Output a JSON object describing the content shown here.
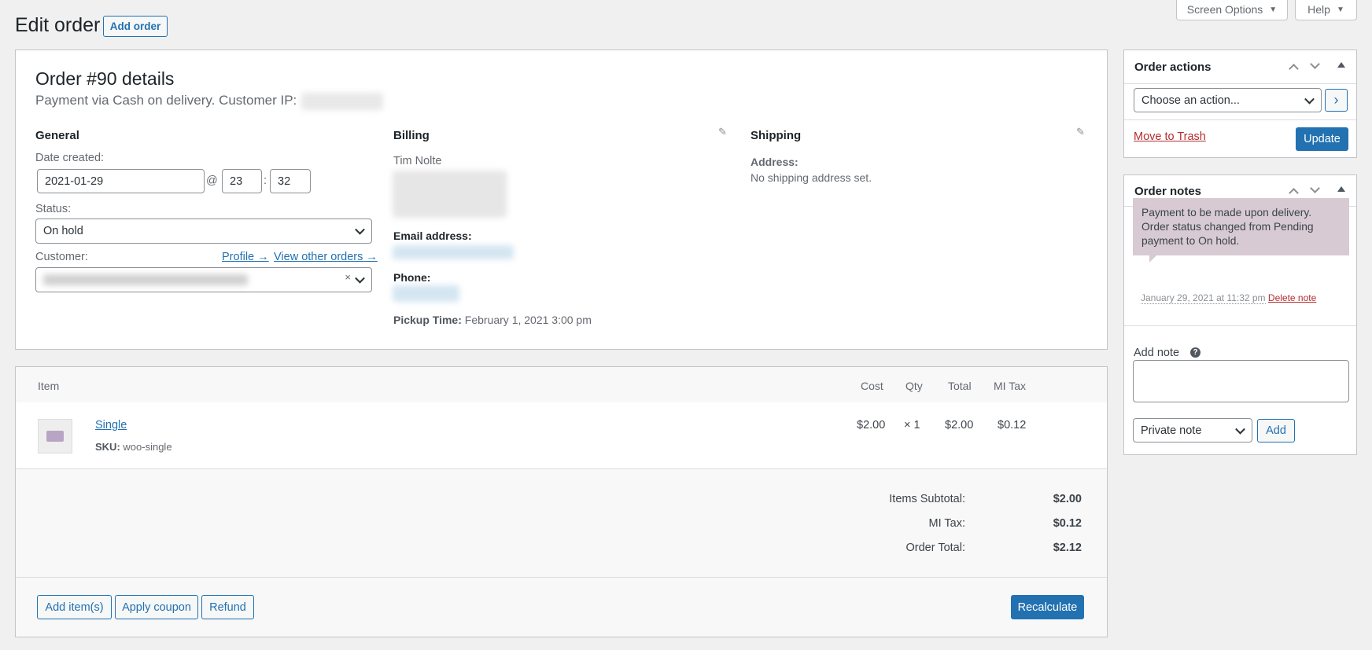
{
  "header": {
    "title": "Edit order",
    "add_order": "Add order",
    "screen_options": "Screen Options",
    "help": "Help"
  },
  "order": {
    "title": "Order #90 details",
    "payment_line": "Payment via Cash on delivery. Customer IP:",
    "general": {
      "heading": "General",
      "date_label": "Date created:",
      "date": "2021-01-29",
      "at": "@",
      "hour": "23",
      "colon": ":",
      "minute": "32",
      "status_label": "Status:",
      "status": "On hold",
      "customer_label": "Customer:",
      "profile_link": "Profile →",
      "other_orders_link": "View other orders →",
      "clear": "×"
    },
    "billing": {
      "heading": "Billing",
      "name": "Tim Nolte",
      "email_label": "Email address:",
      "phone_label": "Phone:",
      "pickup_label": "Pickup Time:",
      "pickup_value": "February 1, 2021 3:00 pm"
    },
    "shipping": {
      "heading": "Shipping",
      "address_label": "Address:",
      "address_value": "No shipping address set."
    }
  },
  "items": {
    "headers": {
      "item": "Item",
      "cost": "Cost",
      "qty": "Qty",
      "total": "Total",
      "tax": "MI Tax"
    },
    "rows": [
      {
        "name": "Single",
        "sku_label": "SKU:",
        "sku": "woo-single",
        "cost": "$2.00",
        "qty": "× 1",
        "total": "$2.00",
        "tax": "$0.12"
      }
    ],
    "totals": [
      {
        "label": "Items Subtotal:",
        "value": "$2.00"
      },
      {
        "label": "MI Tax:",
        "value": "$0.12"
      },
      {
        "label": "Order Total:",
        "value": "$2.12"
      }
    ],
    "buttons": {
      "add_items": "Add item(s)",
      "apply_coupon": "Apply coupon",
      "refund": "Refund",
      "recalculate": "Recalculate"
    }
  },
  "order_actions": {
    "title": "Order actions",
    "select": "Choose an action...",
    "go": "›",
    "trash": "Move to Trash",
    "update": "Update"
  },
  "order_notes": {
    "title": "Order notes",
    "note_text": "Payment to be made upon delivery. Order status changed from Pending payment to On hold.",
    "note_date": "January 29, 2021 at 11:32 pm",
    "delete": "Delete note",
    "add_note_label": "Add note",
    "help": "?",
    "note_type": "Private note",
    "add": "Add"
  },
  "colors": {
    "accent": "#2271b1",
    "danger": "#b32d2e",
    "note_bg": "#d7cad2"
  }
}
